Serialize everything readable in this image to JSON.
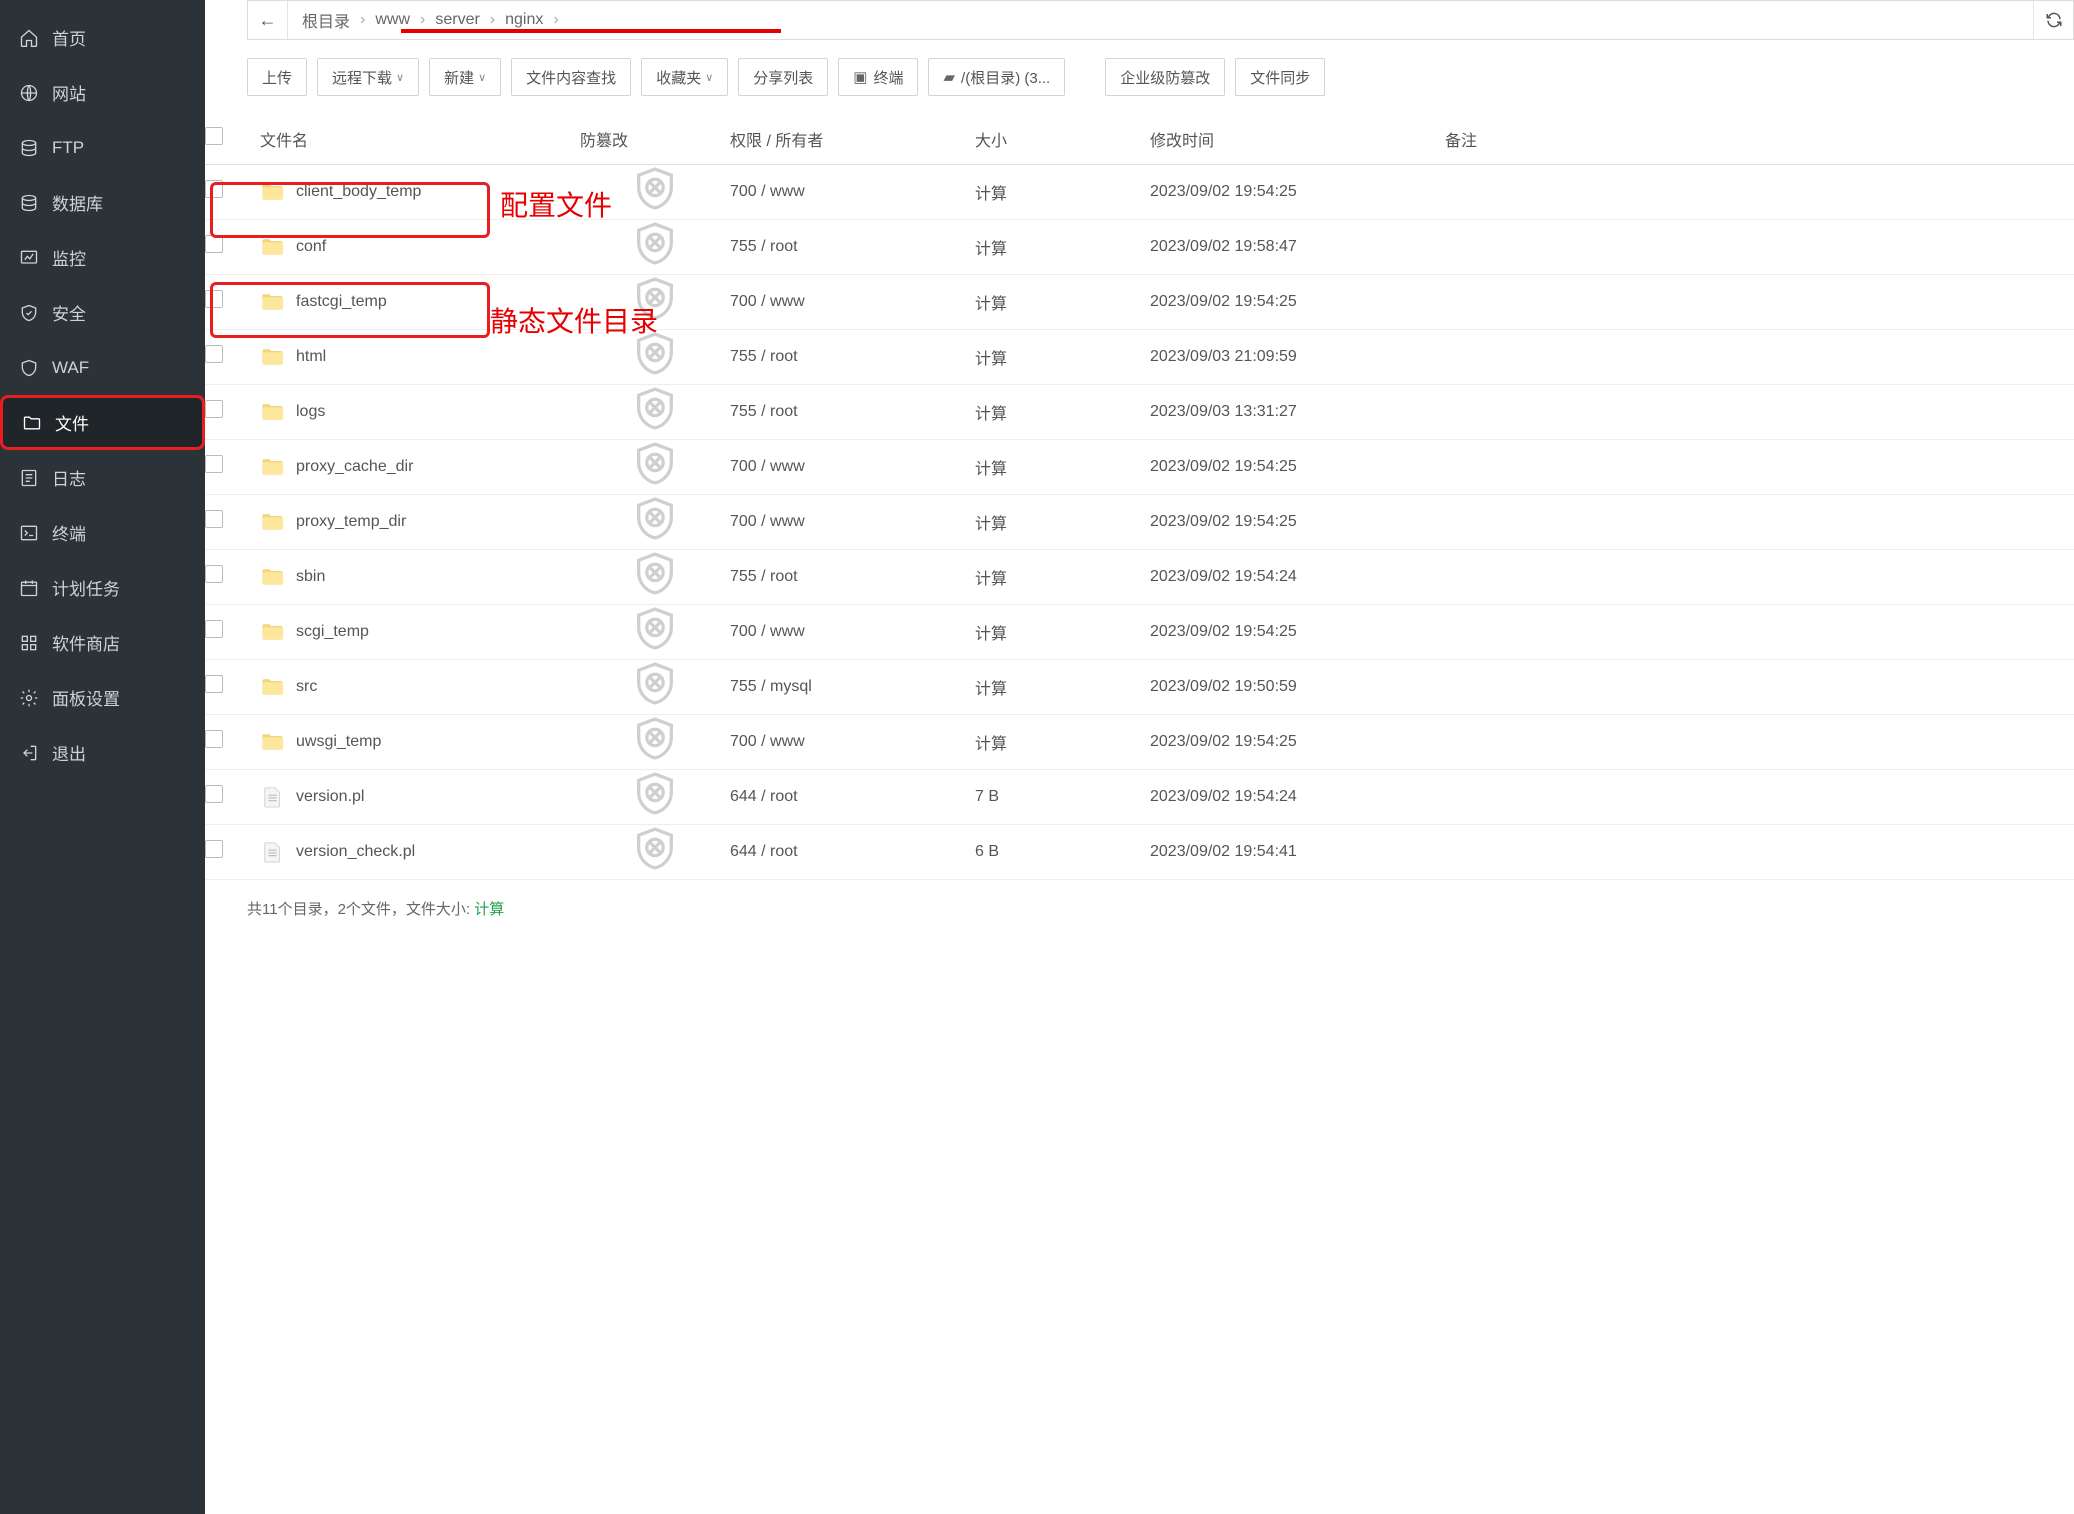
{
  "sidebar": {
    "items": [
      {
        "label": "首页",
        "icon": "home"
      },
      {
        "label": "网站",
        "icon": "globe"
      },
      {
        "label": "FTP",
        "icon": "ftp"
      },
      {
        "label": "数据库",
        "icon": "database"
      },
      {
        "label": "监控",
        "icon": "monitor"
      },
      {
        "label": "安全",
        "icon": "shield"
      },
      {
        "label": "WAF",
        "icon": "waf"
      },
      {
        "label": "文件",
        "icon": "folder",
        "active": true,
        "highlight": true
      },
      {
        "label": "日志",
        "icon": "log"
      },
      {
        "label": "终端",
        "icon": "terminal"
      },
      {
        "label": "计划任务",
        "icon": "calendar"
      },
      {
        "label": "软件商店",
        "icon": "apps"
      },
      {
        "label": "面板设置",
        "icon": "gear"
      },
      {
        "label": "退出",
        "icon": "exit"
      }
    ]
  },
  "breadcrumb": {
    "items": [
      "根目录",
      "www",
      "server",
      "nginx"
    ]
  },
  "toolbar": {
    "upload": "上传",
    "remote_download": "远程下载",
    "new": "新建",
    "content_search": "文件内容查找",
    "favorites": "收藏夹",
    "share_list": "分享列表",
    "terminal": "终端",
    "root_path": "/(根目录) (3...",
    "enterprise_tamper": "企业级防篡改",
    "file_sync": "文件同步"
  },
  "table": {
    "headers": {
      "filename": "文件名",
      "tamper": "防篡改",
      "perm": "权限 / 所有者",
      "size": "大小",
      "mtime": "修改时间",
      "note": "备注"
    },
    "rows": [
      {
        "name": "client_body_temp",
        "type": "folder",
        "perm": "700 / www",
        "size": "计算",
        "mtime": "2023/09/02 19:54:25"
      },
      {
        "name": "conf",
        "type": "folder",
        "perm": "755 / root",
        "size": "计算",
        "mtime": "2023/09/02 19:58:47",
        "highlight": true,
        "anno": "配置文件"
      },
      {
        "name": "fastcgi_temp",
        "type": "folder",
        "perm": "700 / www",
        "size": "计算",
        "mtime": "2023/09/02 19:54:25"
      },
      {
        "name": "html",
        "type": "folder",
        "perm": "755 / root",
        "size": "计算",
        "mtime": "2023/09/03 21:09:59",
        "highlight": true,
        "anno": "静态文件目录"
      },
      {
        "name": "logs",
        "type": "folder",
        "perm": "755 / root",
        "size": "计算",
        "mtime": "2023/09/03 13:31:27"
      },
      {
        "name": "proxy_cache_dir",
        "type": "folder",
        "perm": "700 / www",
        "size": "计算",
        "mtime": "2023/09/02 19:54:25"
      },
      {
        "name": "proxy_temp_dir",
        "type": "folder",
        "perm": "700 / www",
        "size": "计算",
        "mtime": "2023/09/02 19:54:25"
      },
      {
        "name": "sbin",
        "type": "folder",
        "perm": "755 / root",
        "size": "计算",
        "mtime": "2023/09/02 19:54:24"
      },
      {
        "name": "scgi_temp",
        "type": "folder",
        "perm": "700 / www",
        "size": "计算",
        "mtime": "2023/09/02 19:54:25"
      },
      {
        "name": "src",
        "type": "folder",
        "perm": "755 / mysql",
        "size": "计算",
        "mtime": "2023/09/02 19:50:59"
      },
      {
        "name": "uwsgi_temp",
        "type": "folder",
        "perm": "700 / www",
        "size": "计算",
        "mtime": "2023/09/02 19:54:25"
      },
      {
        "name": "version.pl",
        "type": "file",
        "perm": "644 / root",
        "size": "7 B",
        "mtime": "2023/09/02 19:54:24"
      },
      {
        "name": "version_check.pl",
        "type": "file",
        "perm": "644 / root",
        "size": "6 B",
        "mtime": "2023/09/02 19:54:41"
      }
    ]
  },
  "footer": {
    "text_prefix": "共11个目录，2个文件，文件大小: ",
    "calc": "计算"
  },
  "annotations": {
    "conf": "配置文件",
    "html": "静态文件目录"
  }
}
